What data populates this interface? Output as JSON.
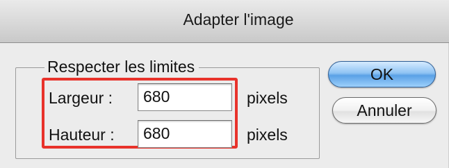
{
  "window": {
    "title": "Adapter l'image"
  },
  "group": {
    "legend": "Respecter les limites"
  },
  "fields": {
    "width": {
      "label": "Largeur :",
      "value": "680",
      "unit": "pixels"
    },
    "height": {
      "label": "Hauteur :",
      "value": "680",
      "unit": "pixels"
    }
  },
  "buttons": {
    "ok": "OK",
    "cancel": "Annuler"
  },
  "colors": {
    "highlight": "#e8322b",
    "default_button": "#5aa1e6"
  }
}
